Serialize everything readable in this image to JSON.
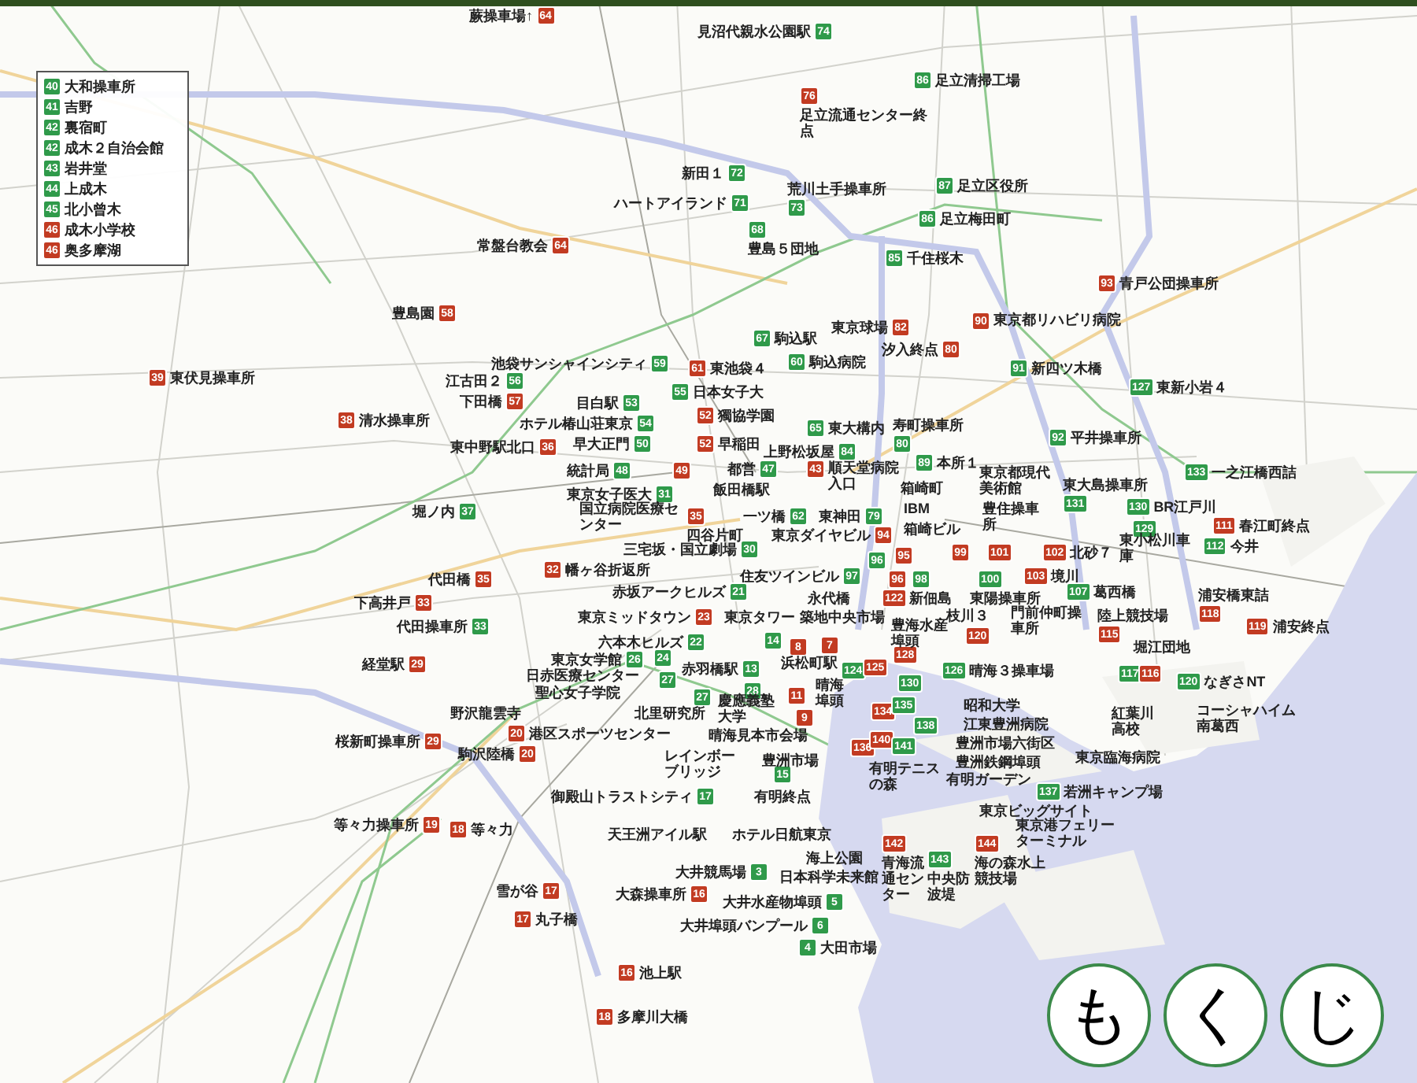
{
  "legend": [
    {
      "number": "40",
      "color": "#2f9a4a",
      "label": "大和操車所"
    },
    {
      "number": "41",
      "color": "#2f9a4a",
      "label": "吉野"
    },
    {
      "number": "42",
      "color": "#2f9a4a",
      "label": "裏宿町"
    },
    {
      "number": "42",
      "color": "#2f9a4a",
      "label": "成木２自治会館"
    },
    {
      "number": "43",
      "color": "#2f9a4a",
      "label": "岩井堂"
    },
    {
      "number": "44",
      "color": "#2f9a4a",
      "label": "上成木"
    },
    {
      "number": "45",
      "color": "#2f9a4a",
      "label": "北小曾木"
    },
    {
      "number": "46",
      "color": "#c23b22",
      "label": "成木小学校"
    },
    {
      "number": "46",
      "color": "#c23b22",
      "label": "奥多摩湖"
    }
  ],
  "pins": [
    {
      "number": "64",
      "color": "#c23b22",
      "label": "蕨操車場↑"
    },
    {
      "number": "74",
      "color": "#2f9a4a",
      "label": "見沼代親水公園駅"
    },
    {
      "number": "86",
      "color": "#2f9a4a",
      "label": "足立清掃工場"
    },
    {
      "number": "76",
      "color": "#c23b22",
      "label": "足立流通センター終点"
    },
    {
      "number": "72",
      "color": "#2f9a4a",
      "label": "新田１"
    },
    {
      "number": "71",
      "color": "#2f9a4a",
      "label": "ハートアイランド"
    },
    {
      "number": "73",
      "color": "#2f9a4a",
      "label": "荒川土手操車所"
    },
    {
      "number": "68",
      "color": "#2f9a4a",
      "label": "豊島５団地"
    },
    {
      "number": "87",
      "color": "#2f9a4a",
      "label": "足立区役所"
    },
    {
      "number": "86",
      "color": "#2f9a4a",
      "label": "足立梅田町"
    },
    {
      "number": "85",
      "color": "#2f9a4a",
      "label": "千住桜木"
    },
    {
      "number": "64",
      "color": "#c23b22",
      "label": "常盤台教会"
    },
    {
      "number": "58",
      "color": "#c23b22",
      "label": "豊島園"
    },
    {
      "number": "39",
      "color": "#c23b22",
      "label": "東伏見操車所"
    },
    {
      "number": "56",
      "color": "#2f9a4a",
      "label": "江古田２"
    },
    {
      "number": "57",
      "color": "#c23b22",
      "label": "下田橋"
    },
    {
      "number": "38",
      "color": "#c23b22",
      "label": "清水操車所"
    },
    {
      "number": "36",
      "color": "#c23b22",
      "label": "東中野駅北口"
    },
    {
      "number": "37",
      "color": "#2f9a4a",
      "label": "堀ノ内"
    },
    {
      "number": "82",
      "color": "#c23b22",
      "label": "東京球場"
    },
    {
      "number": "80",
      "color": "#c23b22",
      "label": "汐入終点"
    },
    {
      "number": "90",
      "color": "#c23b22",
      "label": "東京都リハビリ病院"
    },
    {
      "number": "93",
      "color": "#c23b22",
      "label": "青戸公団操車所"
    },
    {
      "number": "91",
      "color": "#2f9a4a",
      "label": "新四ツ木橋"
    },
    {
      "number": "127",
      "color": "#2f9a4a",
      "label": "東新小岩４"
    },
    {
      "number": "67",
      "color": "#2f9a4a",
      "label": "駒込駅"
    },
    {
      "number": "59",
      "color": "#2f9a4a",
      "label": "池袋サンシャインシティ"
    },
    {
      "number": "61",
      "color": "#c23b22",
      "label": "東池袋４"
    },
    {
      "number": "60",
      "color": "#2f9a4a",
      "label": "駒込病院"
    },
    {
      "number": "55",
      "color": "#2f9a4a",
      "label": "日本女子大"
    },
    {
      "number": "52",
      "color": "#c23b22",
      "label": "獨協学園"
    },
    {
      "number": "53",
      "color": "#2f9a4a",
      "label": "目白駅"
    },
    {
      "number": "54",
      "color": "#2f9a4a",
      "label": "ホテル椿山荘東京"
    },
    {
      "number": "50",
      "color": "#2f9a4a",
      "label": "早大正門"
    },
    {
      "number": "52",
      "color": "#c23b22",
      "label": "早稲田"
    },
    {
      "number": "65",
      "color": "#2f9a4a",
      "label": "東大構内"
    },
    {
      "number": "80",
      "color": "#2f9a4a",
      "label": "寿町操車所"
    },
    {
      "number": "84",
      "color": "#2f9a4a",
      "label": "上野松坂屋"
    },
    {
      "number": "89",
      "color": "#2f9a4a",
      "label": "本所１"
    },
    {
      "number": "48",
      "color": "#2f9a4a",
      "label": "統計局"
    },
    {
      "number": "49",
      "color": "#c23b22"
    },
    {
      "number": "47",
      "color": "#2f9a4a",
      "label": "都営"
    },
    {
      "number": "43",
      "color": "#c23b22",
      "label": "順天堂病院入口"
    },
    {
      "number": "31",
      "color": "#2f9a4a",
      "label": "東京女子医大"
    },
    {
      "number": "35",
      "color": "#c23b22",
      "label": "四谷片町"
    },
    {
      "number": "62",
      "color": "#2f9a4a",
      "label": "一ツ橋"
    },
    {
      "number": "79",
      "color": "#2f9a4a",
      "label": "東神田"
    },
    {
      "number": "92",
      "color": "#2f9a4a",
      "label": "平井操車所"
    },
    {
      "number": "133",
      "color": "#2f9a4a",
      "label": "一之江橋西詰"
    },
    {
      "number": "131",
      "color": "#2f9a4a",
      "label": "東大島操車所"
    },
    {
      "number": "130",
      "color": "#2f9a4a",
      "label": "BR江戸川"
    },
    {
      "number": "129",
      "color": "#2f9a4a"
    },
    {
      "number": "111",
      "color": "#c23b22",
      "label": "春江町終点"
    },
    {
      "number": "94",
      "color": "#c23b22",
      "label": "東京ダイヤビル"
    },
    {
      "number": "30",
      "color": "#2f9a4a",
      "label": "三宅坂・国立劇場"
    },
    {
      "number": "96",
      "color": "#2f9a4a"
    },
    {
      "number": "95",
      "color": "#c23b22"
    },
    {
      "number": "99",
      "color": "#c23b22"
    },
    {
      "number": "101",
      "color": "#c23b22"
    },
    {
      "number": "102",
      "color": "#c23b22",
      "label": "北砂７"
    },
    {
      "number": "112",
      "color": "#2f9a4a",
      "label": "今井"
    },
    {
      "number": "97",
      "color": "#2f9a4a",
      "label": "住友ツインビル"
    },
    {
      "number": "96",
      "color": "#c23b22"
    },
    {
      "number": "98",
      "color": "#2f9a4a"
    },
    {
      "number": "100",
      "color": "#2f9a4a"
    },
    {
      "number": "103",
      "color": "#c23b22",
      "label": "境川"
    },
    {
      "number": "122",
      "color": "#c23b22",
      "label": "新佃島"
    },
    {
      "number": "107",
      "color": "#2f9a4a",
      "label": "葛西橋"
    },
    {
      "number": "118",
      "color": "#c23b22",
      "label": "浦安橋東詰"
    },
    {
      "number": "120",
      "color": "#c23b22"
    },
    {
      "number": "115",
      "color": "#c23b22",
      "label": "陸上競技場"
    },
    {
      "number": "119",
      "color": "#c23b22",
      "label": "浦安終点"
    },
    {
      "number": "126",
      "color": "#2f9a4a",
      "label": "晴海３操車場"
    },
    {
      "number": "117",
      "color": "#2f9a4a"
    },
    {
      "number": "116",
      "color": "#c23b22"
    },
    {
      "number": "120",
      "color": "#2f9a4a",
      "label": "なぎさNT"
    },
    {
      "number": "35",
      "color": "#c23b22",
      "label": "代田橋"
    },
    {
      "number": "33",
      "color": "#c23b22",
      "label": "下高井戸"
    },
    {
      "number": "33",
      "color": "#2f9a4a",
      "label": "代田操車所"
    },
    {
      "number": "29",
      "color": "#c23b22",
      "label": "経堂駅"
    },
    {
      "number": "32",
      "color": "#c23b22",
      "label": "幡ヶ谷折返所"
    },
    {
      "number": "21",
      "color": "#2f9a4a",
      "label": "赤坂アークヒルズ"
    },
    {
      "number": "23",
      "color": "#c23b22",
      "label": "東京ミッドタウン"
    },
    {
      "number": "22",
      "color": "#2f9a4a",
      "label": "六本木ヒルズ"
    },
    {
      "number": "14",
      "color": "#2f9a4a"
    },
    {
      "number": "8",
      "color": "#c23b22"
    },
    {
      "number": "7",
      "color": "#c23b22"
    },
    {
      "number": "26",
      "color": "#2f9a4a",
      "label": "東京女学館"
    },
    {
      "number": "24",
      "color": "#2f9a4a"
    },
    {
      "number": "27",
      "color": "#2f9a4a"
    },
    {
      "number": "13",
      "color": "#2f9a4a",
      "label": "赤羽橋駅"
    },
    {
      "number": "27",
      "color": "#2f9a4a"
    },
    {
      "number": "28",
      "color": "#2f9a4a"
    },
    {
      "number": "11",
      "color": "#c23b22"
    },
    {
      "number": "9",
      "color": "#c23b22"
    },
    {
      "number": "29",
      "color": "#c23b22",
      "label": "桜新町操車所"
    },
    {
      "number": "20",
      "color": "#c23b22",
      "label": "港区スポーツセンター"
    },
    {
      "number": "20",
      "color": "#c23b22",
      "label": "駒沢陸橋"
    },
    {
      "number": "15",
      "color": "#2f9a4a"
    },
    {
      "number": "17",
      "color": "#2f9a4a",
      "label": "御殿山トラストシティ"
    },
    {
      "number": "3",
      "color": "#2f9a4a",
      "label": "大井競馬場"
    },
    {
      "number": "16",
      "color": "#c23b22",
      "label": "大森操車所"
    },
    {
      "number": "5",
      "color": "#2f9a4a",
      "label": "大井水産物埠頭"
    },
    {
      "number": "6",
      "color": "#2f9a4a",
      "label": "大井埠頭バンプール"
    },
    {
      "number": "4",
      "color": "#2f9a4a",
      "label": "大田市場"
    },
    {
      "number": "19",
      "color": "#c23b22",
      "label": "等々力操車所"
    },
    {
      "number": "18",
      "color": "#c23b22",
      "label": "等々力"
    },
    {
      "number": "17",
      "color": "#c23b22",
      "label": "雪が谷"
    },
    {
      "number": "17",
      "color": "#c23b22",
      "label": "丸子橋"
    },
    {
      "number": "16",
      "color": "#c23b22",
      "label": "池上駅"
    },
    {
      "number": "18",
      "color": "#c23b22",
      "label": "多摩川大橋"
    },
    {
      "number": "142",
      "color": "#c23b22",
      "label": "青海流通センター"
    },
    {
      "number": "143",
      "color": "#2f9a4a",
      "label": "中央防波堤"
    },
    {
      "number": "144",
      "color": "#c23b22",
      "label": "海の森水上競技場"
    },
    {
      "number": "137",
      "color": "#2f9a4a",
      "label": "若洲キャンプ場"
    },
    {
      "number": "124",
      "color": "#2f9a4a"
    },
    {
      "number": "125",
      "color": "#c23b22"
    },
    {
      "number": "128",
      "color": "#c23b22"
    },
    {
      "number": "130",
      "color": "#2f9a4a"
    },
    {
      "number": "134",
      "color": "#c23b22"
    },
    {
      "number": "135",
      "color": "#2f9a4a"
    },
    {
      "number": "136",
      "color": "#c23b22"
    },
    {
      "number": "138",
      "color": "#2f9a4a"
    },
    {
      "number": "140",
      "color": "#c23b22"
    },
    {
      "number": "141",
      "color": "#2f9a4a"
    }
  ],
  "place_labels": [
    "国立病院医療センター",
    "飯田橋駅",
    "箱崎町",
    "IBM",
    "箱崎ビル",
    "東京都現代美術館",
    "東小松川車庫",
    "豊住操車所",
    "東陽操車所",
    "永代橋",
    "枝川３",
    "門前仲町操車所",
    "堀江団地",
    "紅葉川高校",
    "東京臨海病院",
    "コーシャハイム南葛西",
    "東京タワー",
    "築地中央市場",
    "豊海水産埠頭",
    "日赤医療センター",
    "聖心女子学院",
    "浜松町駅",
    "晴海埠頭",
    "北里研究所",
    "慶應義塾大学",
    "晴海見本市会場",
    "野沢龍雲寺",
    "レインボーブリッジ",
    "豊洲市場",
    "有明終点",
    "天王洲アイル駅",
    "ホテル日航東京",
    "海上公園",
    "日本科学未来館",
    "有明テニスの森",
    "昭和大学",
    "江東豊洲病院",
    "豊洲市場六街区",
    "豊洲鉄鋼埠頭",
    "有明ガーデン",
    "東京ビッグサイト",
    "東京港フェリーターミナル"
  ],
  "nav_buttons": [
    "も",
    "く",
    "じ"
  ]
}
